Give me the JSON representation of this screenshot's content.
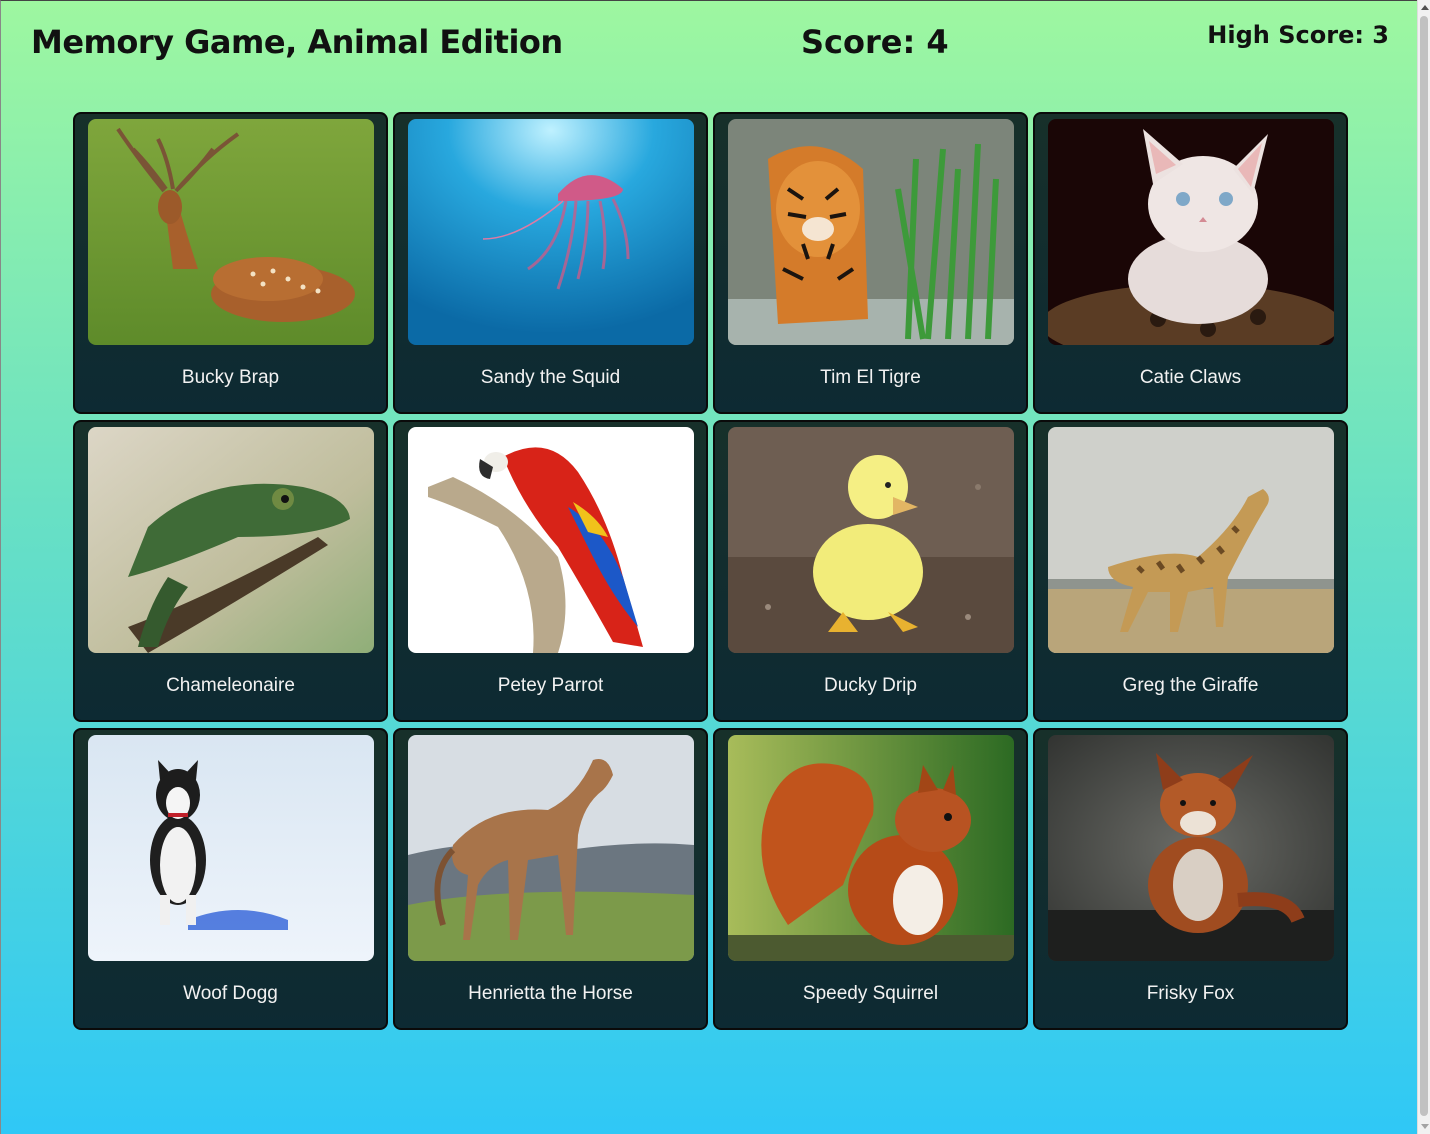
{
  "header": {
    "title": "Memory Game, Animal Edition",
    "score": "Score: 4",
    "high_score": "High Score: 3"
  },
  "cards": [
    {
      "name": "Bucky Brap",
      "icon": "deer-photo"
    },
    {
      "name": "Sandy the Squid",
      "icon": "jellyfish-photo"
    },
    {
      "name": "Tim El Tigre",
      "icon": "tiger-photo"
    },
    {
      "name": "Catie Claws",
      "icon": "kitten-photo"
    },
    {
      "name": "Chameleonaire",
      "icon": "chameleon-photo"
    },
    {
      "name": "Petey Parrot",
      "icon": "parrot-photo"
    },
    {
      "name": "Ducky Drip",
      "icon": "duckling-photo"
    },
    {
      "name": "Greg the Giraffe",
      "icon": "giraffe-photo"
    },
    {
      "name": "Woof Dogg",
      "icon": "husky-photo"
    },
    {
      "name": "Henrietta the Horse",
      "icon": "horse-photo"
    },
    {
      "name": "Speedy Squirrel",
      "icon": "squirrel-photo"
    },
    {
      "name": "Frisky Fox",
      "icon": "fox-photo"
    }
  ],
  "colors": {
    "background_top": "#9ef7a0",
    "background_bottom": "#2fc8f6",
    "card": "#122d2e",
    "card_text": "#f2f2f2"
  }
}
